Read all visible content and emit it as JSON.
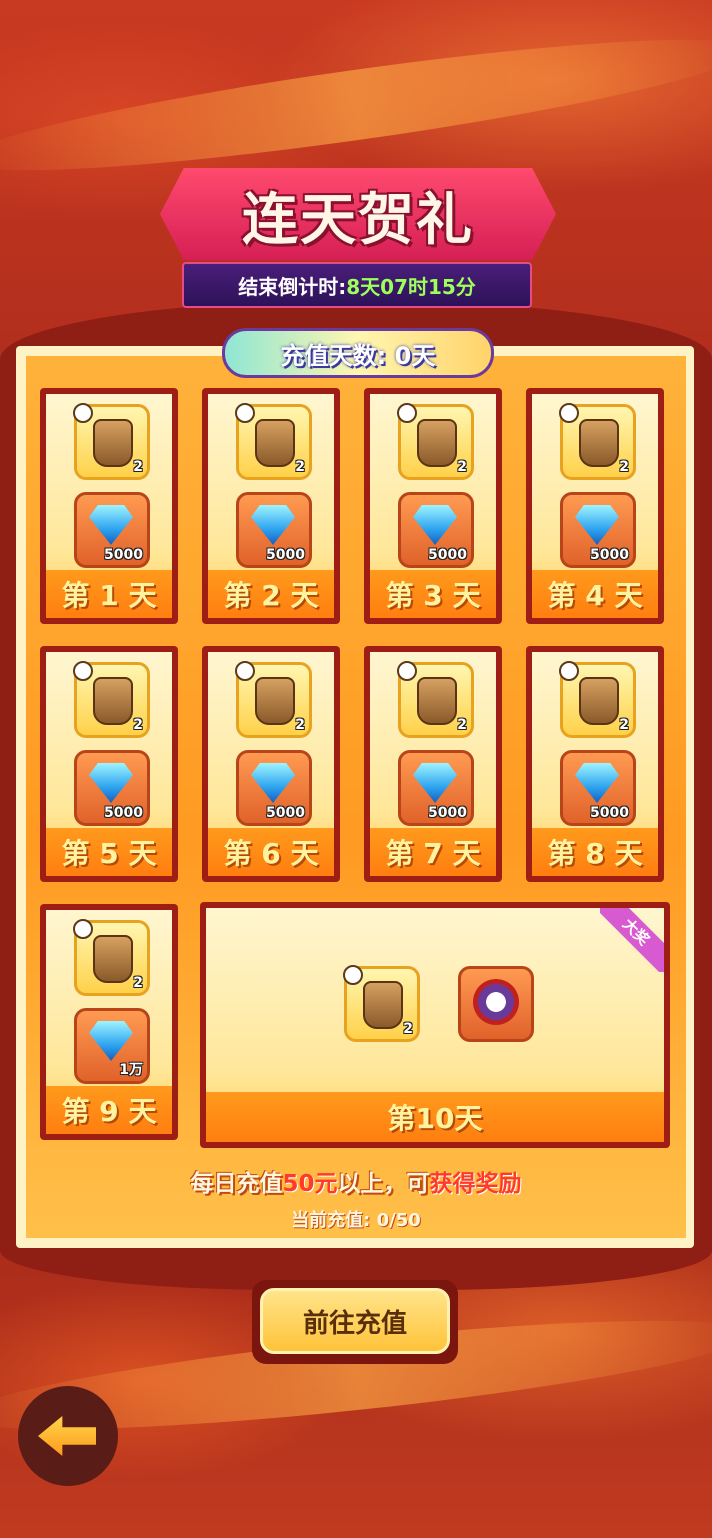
{
  "header": {
    "title": "连天贺礼",
    "countdown_label": "结束倒计时:",
    "countdown_value": "8天07时15分"
  },
  "panel": {
    "recharge_days": "充值天数: 0天"
  },
  "days": [
    {
      "label": "第 1 天",
      "bag_qty": "2",
      "gem_qty": "5000"
    },
    {
      "label": "第 2 天",
      "bag_qty": "2",
      "gem_qty": "5000"
    },
    {
      "label": "第 3 天",
      "bag_qty": "2",
      "gem_qty": "5000"
    },
    {
      "label": "第 4 天",
      "bag_qty": "2",
      "gem_qty": "5000"
    },
    {
      "label": "第 5 天",
      "bag_qty": "2",
      "gem_qty": "5000"
    },
    {
      "label": "第 6 天",
      "bag_qty": "2",
      "gem_qty": "5000"
    },
    {
      "label": "第 7 天",
      "bag_qty": "2",
      "gem_qty": "5000"
    },
    {
      "label": "第 8 天",
      "bag_qty": "2",
      "gem_qty": "5000"
    },
    {
      "label": "第 9 天",
      "bag_qty": "2",
      "gem_qty": "1万"
    }
  ],
  "grand_prize": {
    "label": "第10天",
    "ribbon": "大奖",
    "bag_qty": "2"
  },
  "rule": {
    "prefix": "每日充值",
    "amount": "50元",
    "middle": "以上，可",
    "suffix": "获得奖励"
  },
  "progress": "当前充值: 0/50",
  "buttons": {
    "go_recharge": "前往充值"
  },
  "icons": {
    "bag": "supply-bag-icon",
    "gem": "diamond-icon",
    "clock": "clock-icon",
    "hero": "hero-portrait-icon",
    "back": "back-arrow-icon"
  },
  "colors": {
    "background": "#b52a1c",
    "accent_orange": "#ff9a22",
    "countdown_value": "#9dff5a",
    "rule_highlight": "#ff3a2a"
  }
}
